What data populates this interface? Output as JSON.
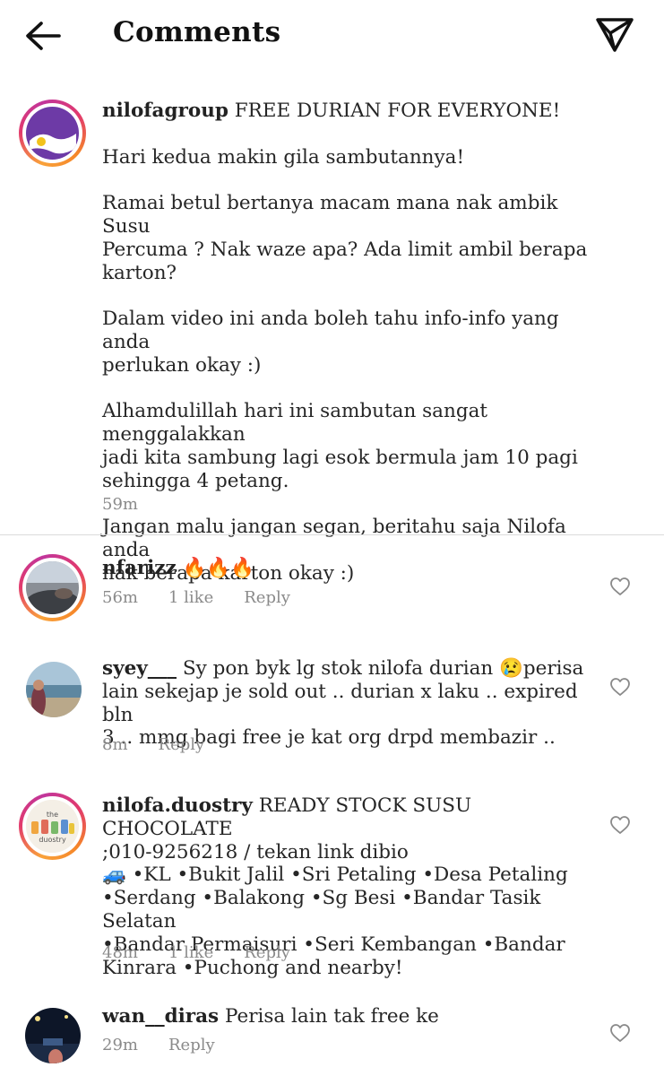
{
  "header": {
    "title": "Comments"
  },
  "caption": {
    "username": "nilofagroup",
    "text": "FREE DURIAN FOR EVERYONE!\n\nHari kedua makin gila sambutannya!\n\nRamai betul bertanya macam mana nak ambik Susu\nPercuma ? Nak waze apa? Ada limit ambil berapa\nkarton?\n\nDalam video ini anda boleh tahu info-info yang anda\nperlukan okay :)\n\nAlhamdulillah hari ini sambutan sangat menggalakkan\njadi kita sambung lagi esok bermula jam 10 pagi\nsehingga 4 petang.\n\nJangan malu jangan segan, beritahu saja Nilofa anda\nnak berapa karton okay :)",
    "time": "59m"
  },
  "comments": [
    {
      "username": "nfarizz",
      "text": "🔥🔥🔥",
      "time": "56m",
      "likes": "1 like",
      "reply": "Reply"
    },
    {
      "username": "syey___",
      "text": "Sy pon byk lg stok nilofa durian 😢perisa\nlain sekejap je sold out .. durian x laku .. expired bln\n3 .. mmg bagi free je kat org drpd membazir ..",
      "time": "8m",
      "reply": "Reply"
    },
    {
      "username": "nilofa.duostry",
      "text": "READY STOCK SUSU CHOCOLATE\n;010-9256218 / tekan link dibio\n🚙 •KL •Bukit Jalil •Sri Petaling •Desa Petaling\n•Serdang •Balakong •Sg Besi •Bandar Tasik Selatan\n•Bandar Permaisuri •Seri Kembangan •Bandar\nKinrara •Puchong and nearby!",
      "time": "48m",
      "likes": "1 like",
      "reply": "Reply"
    },
    {
      "username": "wan__diras",
      "text": "Perisa lain tak free ke",
      "time": "29m",
      "reply": "Reply"
    }
  ],
  "avatar_4_text": "the duostry",
  "colors": {
    "text": "#262626",
    "meta": "#8a8a8a",
    "divider": "#dbdbdb"
  },
  "icons": [
    "back-arrow-icon",
    "send-icon",
    "heart-icon"
  ]
}
